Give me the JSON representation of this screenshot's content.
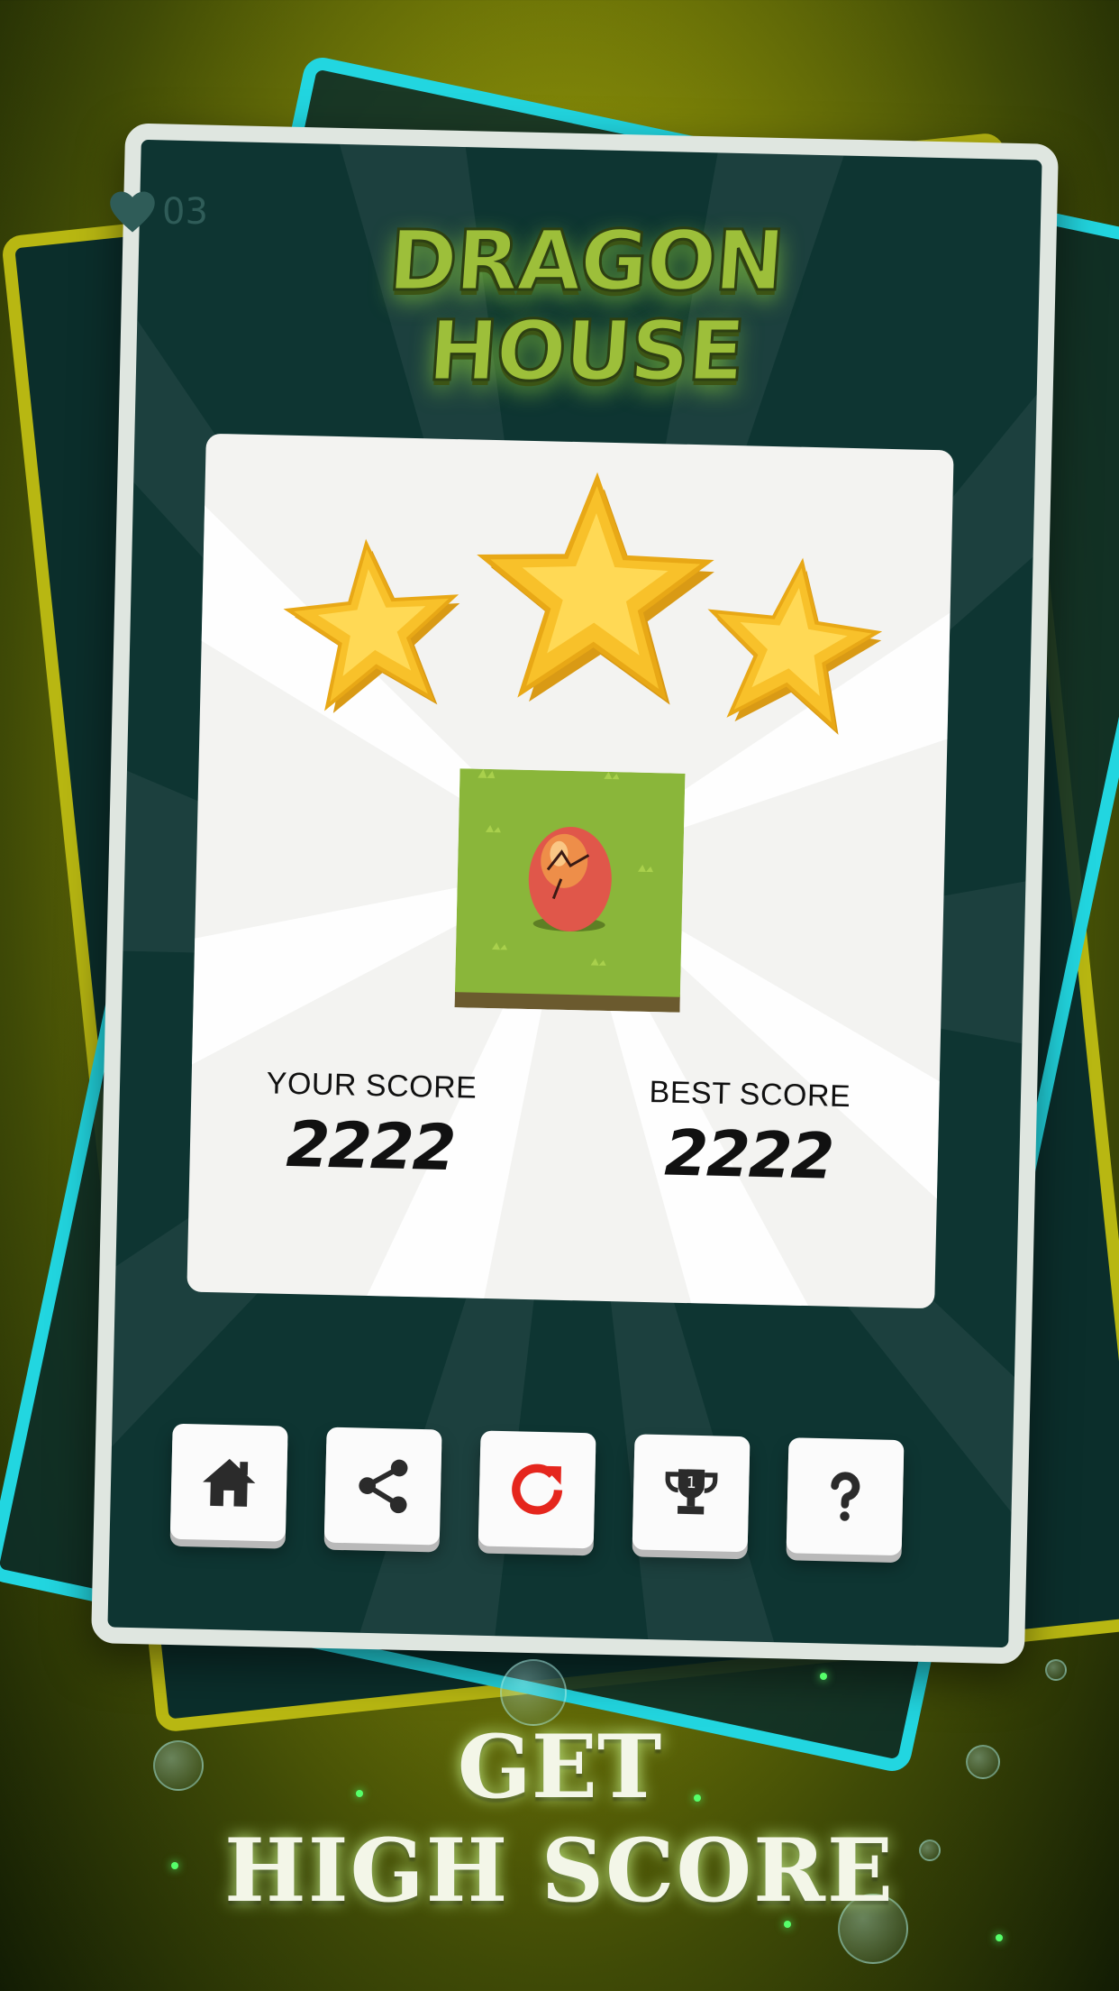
{
  "game": {
    "title_line1": "DRAGON",
    "title_line2": "HOUSE",
    "lives": "03"
  },
  "result": {
    "stars_earned": 3,
    "stars_total": 3,
    "your_score_label": "YOUR SCORE",
    "your_score_value": "2222",
    "best_score_label": "BEST SCORE",
    "best_score_value": "2222"
  },
  "buttons": [
    {
      "name": "home",
      "icon": "home-icon"
    },
    {
      "name": "share",
      "icon": "share-icon"
    },
    {
      "name": "replay",
      "icon": "replay-icon"
    },
    {
      "name": "leaderboard",
      "icon": "trophy-icon"
    },
    {
      "name": "help",
      "icon": "question-icon"
    }
  ],
  "cta": {
    "line1": "GET",
    "line2": "HIGH SCORE"
  },
  "colors": {
    "background": "#8a8f08",
    "card": "#0e3532",
    "accent_cyan": "#22d6e0",
    "accent_yellow": "#b8b712",
    "star": "#f8c12a",
    "replay_icon": "#e5261d"
  }
}
